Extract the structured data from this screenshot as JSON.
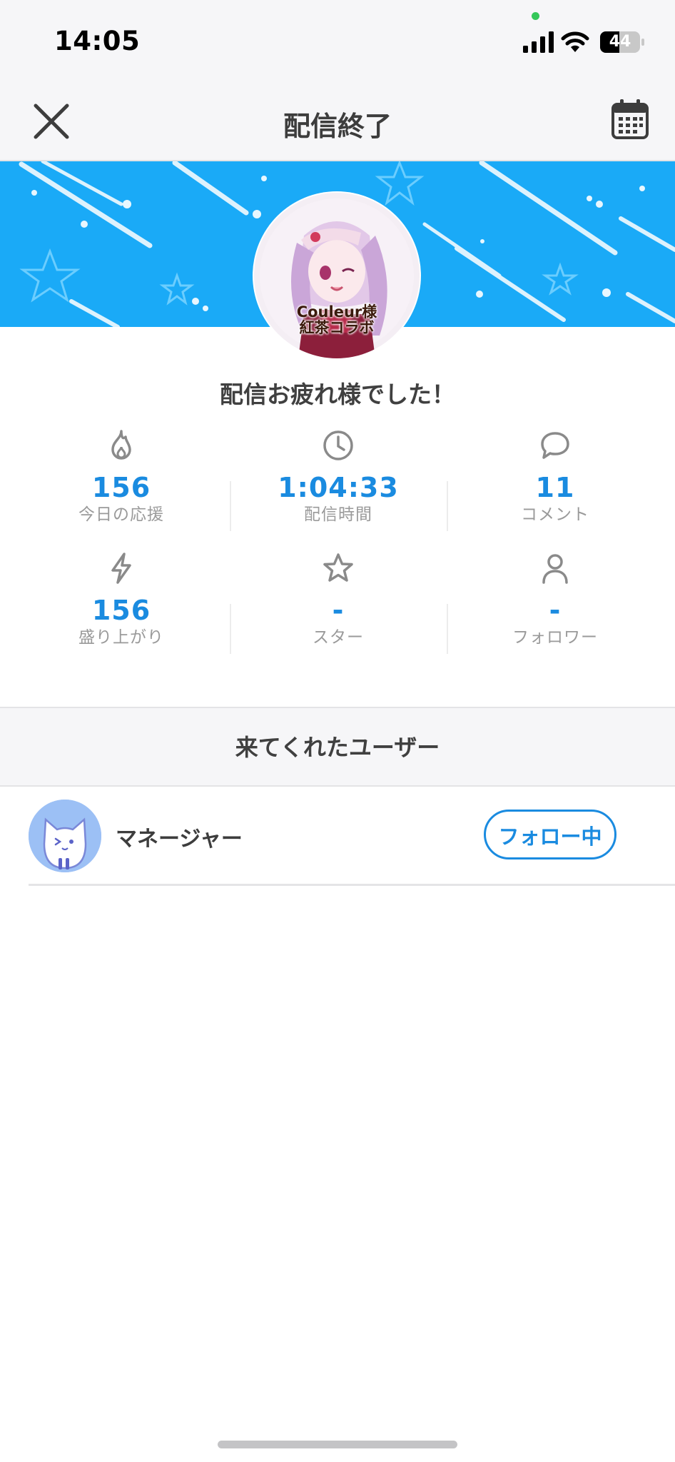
{
  "status_bar": {
    "time": "14:05",
    "battery": "44"
  },
  "nav": {
    "title": "配信終了",
    "close_icon": "close-icon",
    "calendar_icon": "calendar-icon"
  },
  "banner": {
    "avatar_caption_line1": "Couleur様",
    "avatar_caption_line2": "紅茶コラボ"
  },
  "greeting": "配信お疲れ様でした！",
  "stats": [
    {
      "icon": "flame-icon",
      "value": "156",
      "label": "今日の応援"
    },
    {
      "icon": "clock-icon",
      "value": "1:04:33",
      "label": "配信時間"
    },
    {
      "icon": "comment-icon",
      "value": "11",
      "label": "コメント"
    },
    {
      "icon": "lightning-icon",
      "value": "156",
      "label": "盛り上がり"
    },
    {
      "icon": "star-icon",
      "value": "-",
      "label": "スター"
    },
    {
      "icon": "person-icon",
      "value": "-",
      "label": "フォロワー"
    }
  ],
  "visitors": {
    "title": "来てくれたユーザー",
    "users": [
      {
        "name": "マネージャー",
        "button_label": "フォロー中"
      }
    ]
  },
  "colors": {
    "accent": "#1a8be0",
    "banner": "#1aaaf7",
    "background": "#f6f6f8"
  }
}
